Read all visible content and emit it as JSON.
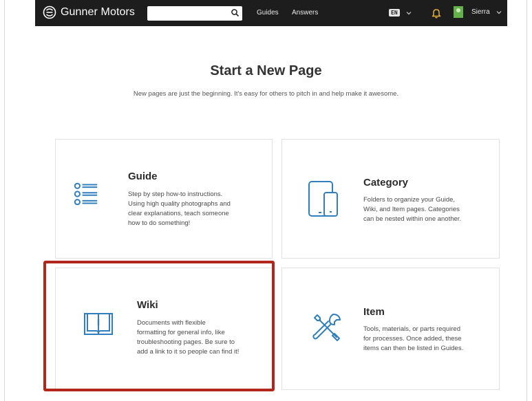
{
  "header": {
    "brand": "Gunner Motors",
    "search_placeholder": "",
    "nav": [
      "Guides",
      "Answers"
    ],
    "language": "EN",
    "user_name": "Sierra"
  },
  "page": {
    "title": "Start a New Page",
    "subtitle": "New pages are just the beginning. It's easy for others to pitch in and help make it awesome."
  },
  "cards": {
    "guide": {
      "title": "Guide",
      "lines": [
        "Step by step how-to instructions.",
        "Using high quality photographs and",
        "clear explanations, teach someone",
        "how to do something!"
      ],
      "icon": "list-icon"
    },
    "category": {
      "title": "Category",
      "lines": [
        "Folders to organize your Guide,",
        "Wiki, and Item pages. Categories",
        "can be nested within one another."
      ],
      "icon": "devices-icon"
    },
    "wiki": {
      "title": "Wiki",
      "lines": [
        "Documents with flexible",
        "formatting for general info, like",
        "troubleshooting pages. Be sure to",
        "add a link to it so people can find it!"
      ],
      "icon": "book-icon"
    },
    "item": {
      "title": "Item",
      "lines": [
        "Tools, materials, or parts required",
        "for processes. Once added, these",
        "items can then be listed in Guides."
      ],
      "icon": "tools-icon"
    }
  },
  "colors": {
    "accent": "#2f7fbf",
    "highlight": "#b3261b",
    "header_bg": "#1d1d1d"
  }
}
